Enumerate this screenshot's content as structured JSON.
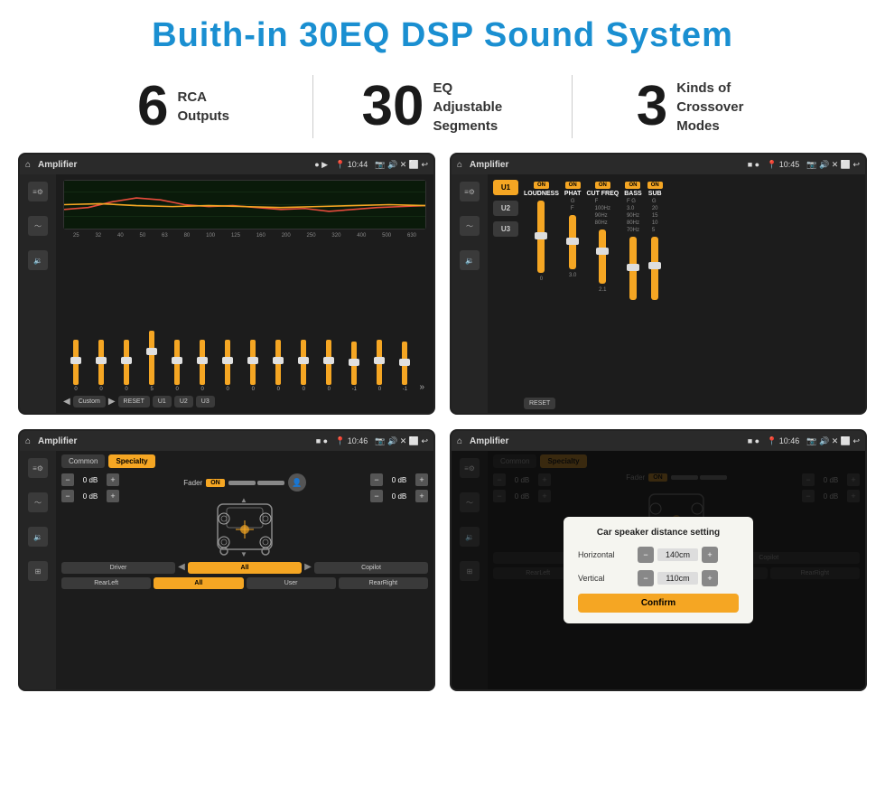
{
  "header": {
    "title": "Buith-in 30EQ DSP Sound System"
  },
  "stats": [
    {
      "number": "6",
      "text": "RCA\nOutputs"
    },
    {
      "number": "30",
      "text": "EQ Adjustable\nSegments"
    },
    {
      "number": "3",
      "text": "Kinds of\nCrossover Modes"
    }
  ],
  "screens": [
    {
      "id": "screen1",
      "topbar": {
        "title": "Amplifier",
        "time": "10:44"
      },
      "type": "eq"
    },
    {
      "id": "screen2",
      "topbar": {
        "title": "Amplifier",
        "time": "10:45"
      },
      "type": "crossover"
    },
    {
      "id": "screen3",
      "topbar": {
        "title": "Amplifier",
        "time": "10:46"
      },
      "type": "fader"
    },
    {
      "id": "screen4",
      "topbar": {
        "title": "Amplifier",
        "time": "10:46"
      },
      "type": "fader-dialog",
      "dialog": {
        "title": "Car speaker distance setting",
        "horizontal_label": "Horizontal",
        "horizontal_value": "140cm",
        "vertical_label": "Vertical",
        "vertical_value": "110cm",
        "confirm_label": "Confirm"
      }
    }
  ],
  "eq": {
    "frequencies": [
      "25",
      "32",
      "40",
      "50",
      "63",
      "80",
      "100",
      "125",
      "160",
      "200",
      "250",
      "320",
      "400",
      "500",
      "630"
    ],
    "values": [
      "0",
      "0",
      "0",
      "5",
      "0",
      "0",
      "0",
      "0",
      "0",
      "0",
      "0",
      "-1",
      "0",
      "-1"
    ],
    "presets": [
      "Custom",
      "RESET",
      "U1",
      "U2",
      "U3"
    ],
    "sliders": [
      50,
      50,
      50,
      60,
      50,
      50,
      50,
      50,
      50,
      50,
      50,
      45,
      50,
      45
    ]
  },
  "crossover": {
    "presets": [
      "U1",
      "U2",
      "U3"
    ],
    "channels": [
      "LOUDNESS",
      "PHAT",
      "CUT FREQ",
      "BASS",
      "SUB"
    ],
    "reset_label": "RESET"
  },
  "fader": {
    "modes": [
      "Common",
      "Specialty"
    ],
    "fader_label": "Fader",
    "on_label": "ON",
    "db_values": [
      "0 dB",
      "0 dB",
      "0 dB",
      "0 dB"
    ],
    "buttons": [
      "Driver",
      "RearLeft",
      "All",
      "User",
      "RearRight",
      "Copilot"
    ]
  }
}
